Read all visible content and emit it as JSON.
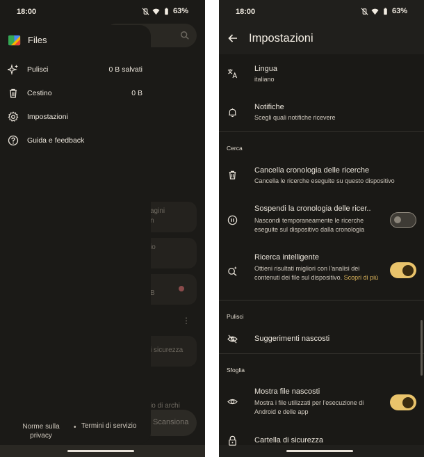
{
  "status": {
    "time": "18:00",
    "battery": "63%"
  },
  "left": {
    "background": {
      "cards": [
        {
          "line1": "agini",
          "line2": "n"
        },
        {
          "line1": "io",
          "line2": ""
        },
        {
          "line1": "B",
          "line2": ""
        },
        {
          "line1": "i sicurezza",
          "line2": ""
        },
        {
          "line1": "io di archi",
          "line2": ""
        }
      ],
      "scan_label": "Scansiona"
    },
    "drawer": {
      "app_name": "Files",
      "items": [
        {
          "label": "Pulisci",
          "value": "0 B salvati",
          "icon": "sparkle-icon"
        },
        {
          "label": "Cestino",
          "value": "0 B",
          "icon": "trash-icon"
        },
        {
          "label": "Impostazioni",
          "value": "",
          "icon": "gear-icon"
        },
        {
          "label": "Guida e feedback",
          "value": "",
          "icon": "help-icon"
        }
      ],
      "footer": {
        "privacy": "Norme sulla privacy",
        "separator": "•",
        "terms": "Termini di servizio"
      }
    }
  },
  "right": {
    "title": "Impostazioni",
    "rows": [
      {
        "title": "Lingua",
        "subtitle": "italiano",
        "icon": "translate-icon"
      },
      {
        "title": "Notifiche",
        "subtitle": "Scegli quali notifiche ricevere",
        "icon": "bell-icon"
      },
      {
        "title": "Cancella cronologia delle ricerche",
        "subtitle": "Cancella le ricerche eseguite su questo dispositivo",
        "icon": "trash-icon"
      },
      {
        "title": "Sospendi la cronologia delle ricer..",
        "subtitle": "Nascondi temporaneamente le ricerche eseguite sul dispositivo dalla cronologia",
        "icon": "pause-icon",
        "toggle": false
      },
      {
        "title": "Ricerca intelligente",
        "subtitle": "Ottieni risultati migliori con l'analisi dei contenuti dei file sul dispositivo.",
        "link": "Scopri di più",
        "icon": "smart-search-icon",
        "toggle": true
      },
      {
        "title": "Suggerimenti nascosti",
        "subtitle": "",
        "icon": "eye-off-icon"
      },
      {
        "title": "Mostra file nascosti",
        "subtitle": "Mostra i file utilizzati per l'esecuzione di Android e delle app",
        "icon": "eye-icon",
        "toggle": true
      },
      {
        "title": "Cartella di sicurezza",
        "subtitle": "",
        "icon": "lock-icon"
      }
    ],
    "sections": {
      "cerca": "Cerca",
      "pulisci": "Pulisci",
      "sfoglia": "Sfoglia"
    },
    "colors": {
      "accent": "#e9c36b",
      "link": "#d9b25a"
    }
  }
}
